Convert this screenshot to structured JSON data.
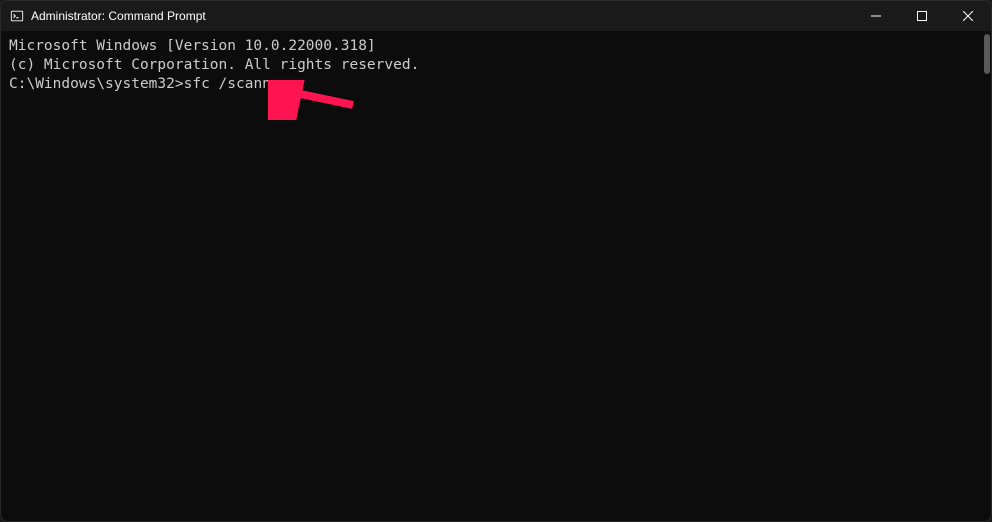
{
  "titlebar": {
    "title": "Administrator: Command Prompt"
  },
  "terminal": {
    "line1": "Microsoft Windows [Version 10.0.22000.318]",
    "line2": "(c) Microsoft Corporation. All rights reserved.",
    "blank": "",
    "prompt": "C:\\Windows\\system32>",
    "command": "sfc /scannow"
  }
}
